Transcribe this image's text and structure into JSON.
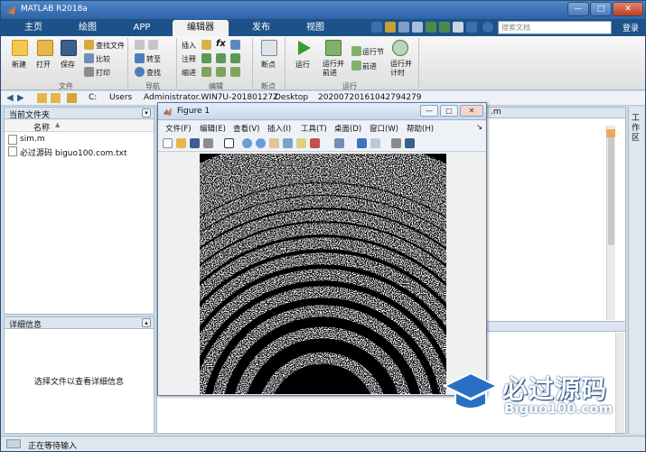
{
  "window": {
    "title": "MATLAB R2018a",
    "minimize": "—",
    "maximize": "□",
    "close": "✕"
  },
  "tabs": [
    "主页",
    "绘图",
    "APP",
    "编辑器",
    "发布",
    "视图"
  ],
  "active_tab": "编辑器",
  "search": {
    "placeholder": "搜索文档"
  },
  "help_link": "登录",
  "ribbon": {
    "file_group": {
      "label": "文件",
      "new": "新建",
      "open": "打开",
      "save": "保存",
      "find_files": "查找文件",
      "compare": "比较",
      "print": "打印"
    },
    "nav_group": {
      "label": "导航",
      "goto": "转至",
      "find": "查找"
    },
    "edit_group": {
      "label": "编辑",
      "insert": "插入",
      "comment": "注释",
      "indent": "缩进",
      "fx": "fx"
    },
    "breakpoint_group": {
      "label": "断点",
      "breakpoints": "断点"
    },
    "run_group": {
      "label": "运行",
      "run": "运行",
      "run_advance": "运行并\n前进",
      "run_section": "运行节",
      "advance": "前进",
      "run_time": "运行并\n计时"
    }
  },
  "address": {
    "segments": [
      "C:",
      "Users",
      "Administrator.WIN7U-20180127Z",
      "Desktop",
      "20200720161042794279"
    ]
  },
  "file_panel": {
    "title": "当前文件夹",
    "column": "名称",
    "files": [
      "sim.m",
      "必过源码 biguo100.com.txt"
    ]
  },
  "detail_panel": {
    "title": "详细信息",
    "placeholder": "选择文件以查看详细信息"
  },
  "side_strip": {
    "label": "工作区"
  },
  "status": {
    "text": "正在等待输入"
  },
  "figure": {
    "title": "Figure 1",
    "menu": [
      "文件(F)",
      "编辑(E)",
      "查看(V)",
      "插入(I)",
      "工具(T)",
      "桌面(D)",
      "窗口(W)",
      "帮助(H)"
    ],
    "menu_overflow": "↘",
    "minimize": "—",
    "maximize": "□",
    "close": "✕"
  },
  "workspace_partial": {
    "fragment": ".m"
  },
  "watermark": {
    "brand_cn": "必过源码",
    "brand_en": "Biguo100.com"
  },
  "colors": {
    "titlebar": "#2e64a6",
    "ribbon": "#f2f2f2",
    "accent": "#1d5189"
  },
  "icons": [
    "matlab-logo-icon",
    "new-file-icon",
    "open-folder-icon",
    "save-icon",
    "run-icon",
    "breakpoint-icon",
    "zoom-in-icon",
    "zoom-out-icon",
    "pan-icon",
    "rotate-icon",
    "data-cursor-icon",
    "brush-icon",
    "colorbar-icon",
    "legend-icon"
  ]
}
